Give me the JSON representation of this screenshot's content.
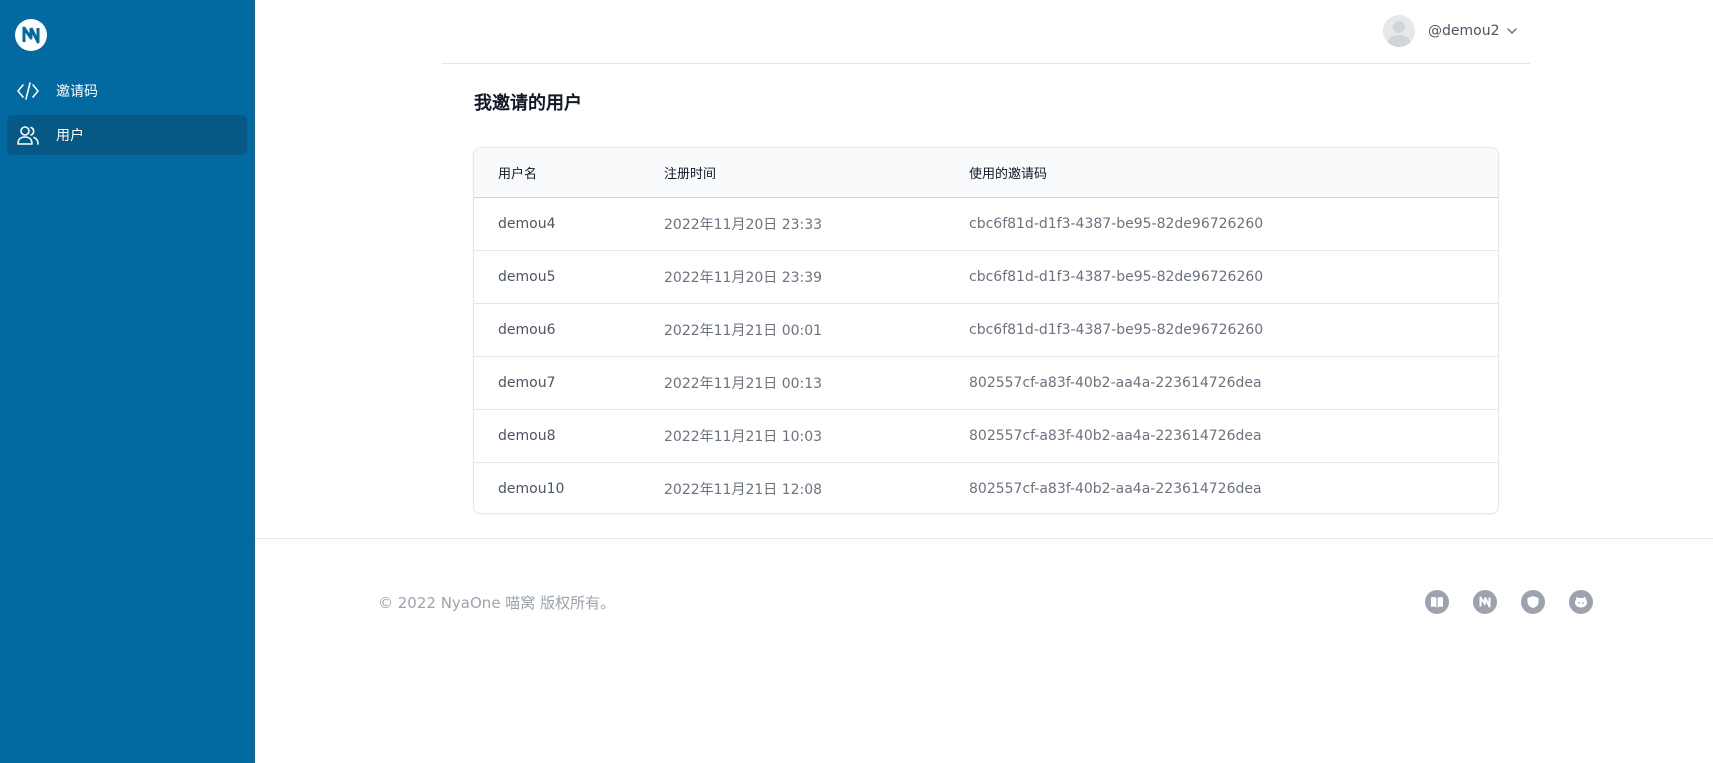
{
  "sidebar": {
    "logo_icon": "nyaone-logo-icon",
    "items": [
      {
        "label": "邀请码",
        "icon": "code-icon",
        "active": false
      },
      {
        "label": "用户",
        "icon": "users-icon",
        "active": true
      }
    ],
    "background_color": "#0369a1",
    "active_color": "#075985"
  },
  "header": {
    "username": "@demou2",
    "avatar_icon": "avatar-placeholder-icon",
    "menu_icon": "chevron-down-icon"
  },
  "main": {
    "title": "我邀请的用户",
    "table": {
      "columns": [
        "用户名",
        "注册时间",
        "使用的邀请码"
      ],
      "rows": [
        {
          "username": "demou4",
          "time": "2022年11月20日 23:33",
          "code": "cbc6f81d-d1f3-4387-be95-82de96726260"
        },
        {
          "username": "demou5",
          "time": "2022年11月20日 23:39",
          "code": "cbc6f81d-d1f3-4387-be95-82de96726260"
        },
        {
          "username": "demou6",
          "time": "2022年11月21日 00:01",
          "code": "cbc6f81d-d1f3-4387-be95-82de96726260"
        },
        {
          "username": "demou7",
          "time": "2022年11月21日 00:13",
          "code": "802557cf-a83f-40b2-aa4a-223614726dea"
        },
        {
          "username": "demou8",
          "time": "2022年11月21日 10:03",
          "code": "802557cf-a83f-40b2-aa4a-223614726dea"
        },
        {
          "username": "demou10",
          "time": "2022年11月21日 12:08",
          "code": "802557cf-a83f-40b2-aa4a-223614726dea"
        }
      ]
    }
  },
  "footer": {
    "copyright": "© 2022 NyaOne 喵窝 版权所有。",
    "links": [
      {
        "icon": "book-icon"
      },
      {
        "icon": "nyaone-logo-icon"
      },
      {
        "icon": "shield-icon"
      },
      {
        "icon": "github-icon"
      }
    ]
  }
}
